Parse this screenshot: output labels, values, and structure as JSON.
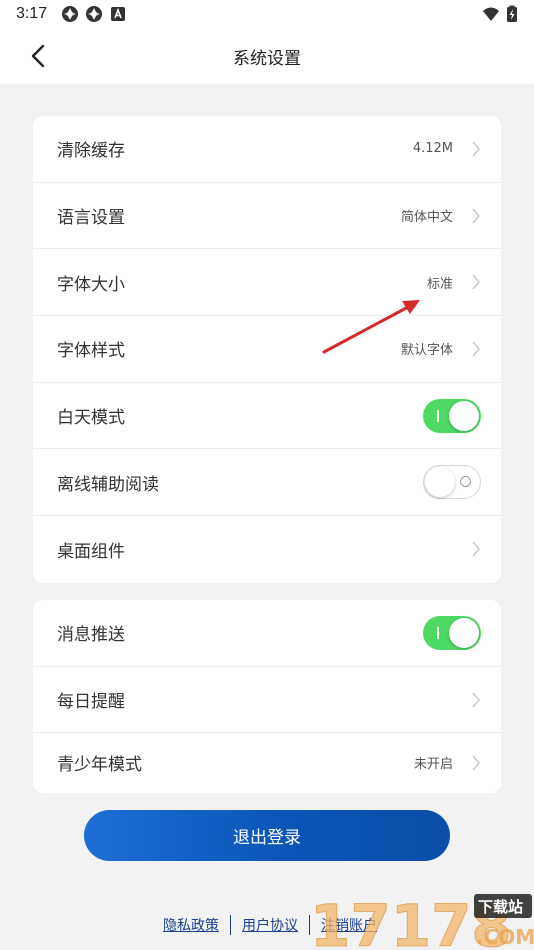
{
  "status_bar": {
    "time": "3:17",
    "icons": [
      "app-icon",
      "app-icon",
      "a-badge-icon"
    ],
    "right_icons": [
      "wifi-icon",
      "battery-icon"
    ]
  },
  "header": {
    "title": "系统设置",
    "back_icon": "chevron-left-icon"
  },
  "settings_group_1": {
    "rows": [
      {
        "label": "清除缓存",
        "value": "4.12M",
        "type": "link"
      },
      {
        "label": "语言设置",
        "value": "简体中文",
        "type": "link"
      },
      {
        "label": "字体大小",
        "value": "标准",
        "type": "link"
      },
      {
        "label": "字体样式",
        "value": "默认字体",
        "type": "link"
      },
      {
        "label": "白天模式",
        "value": "",
        "type": "toggle",
        "on": true
      },
      {
        "label": "离线辅助阅读",
        "value": "",
        "type": "toggle",
        "on": false
      },
      {
        "label": "桌面组件",
        "value": "",
        "type": "link"
      }
    ]
  },
  "settings_group_2": {
    "rows": [
      {
        "label": "消息推送",
        "value": "",
        "type": "toggle",
        "on": true
      },
      {
        "label": "每日提醒",
        "value": "",
        "type": "link"
      },
      {
        "label": "青少年模式",
        "value": "未开启",
        "type": "link"
      }
    ]
  },
  "logout_label": "退出登录",
  "footer": {
    "links": [
      "隐私政策",
      "用户协议",
      "注销账户"
    ]
  },
  "watermark": {
    "text": "17178",
    "badge": "下载站",
    "suffix": ".COM"
  },
  "colors": {
    "toggle_on": "#4cd964",
    "logout_start": "#1d6fd6",
    "logout_end": "#0a4ea8",
    "link": "#1a3f8f",
    "annotation_arrow": "#d42a2a"
  }
}
